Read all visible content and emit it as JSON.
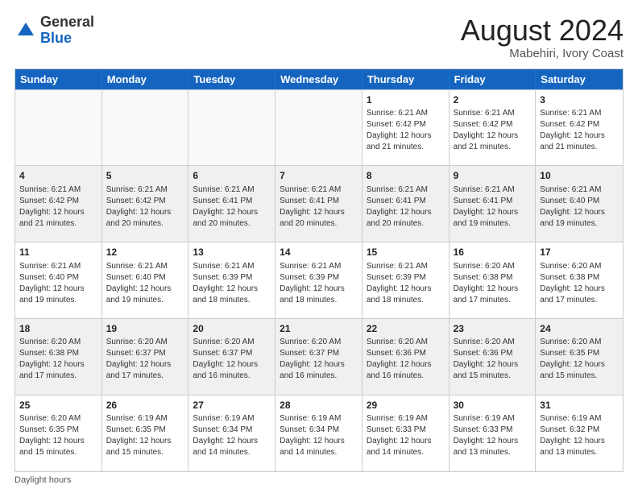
{
  "header": {
    "logo_general": "General",
    "logo_blue": "Blue",
    "title": "August 2024",
    "location": "Mabehiri, Ivory Coast"
  },
  "days_of_week": [
    "Sunday",
    "Monday",
    "Tuesday",
    "Wednesday",
    "Thursday",
    "Friday",
    "Saturday"
  ],
  "weeks": [
    [
      {
        "day": "",
        "info": ""
      },
      {
        "day": "",
        "info": ""
      },
      {
        "day": "",
        "info": ""
      },
      {
        "day": "",
        "info": ""
      },
      {
        "day": "1",
        "info": "Sunrise: 6:21 AM\nSunset: 6:42 PM\nDaylight: 12 hours\nand 21 minutes."
      },
      {
        "day": "2",
        "info": "Sunrise: 6:21 AM\nSunset: 6:42 PM\nDaylight: 12 hours\nand 21 minutes."
      },
      {
        "day": "3",
        "info": "Sunrise: 6:21 AM\nSunset: 6:42 PM\nDaylight: 12 hours\nand 21 minutes."
      }
    ],
    [
      {
        "day": "4",
        "info": "Sunrise: 6:21 AM\nSunset: 6:42 PM\nDaylight: 12 hours\nand 21 minutes."
      },
      {
        "day": "5",
        "info": "Sunrise: 6:21 AM\nSunset: 6:42 PM\nDaylight: 12 hours\nand 20 minutes."
      },
      {
        "day": "6",
        "info": "Sunrise: 6:21 AM\nSunset: 6:41 PM\nDaylight: 12 hours\nand 20 minutes."
      },
      {
        "day": "7",
        "info": "Sunrise: 6:21 AM\nSunset: 6:41 PM\nDaylight: 12 hours\nand 20 minutes."
      },
      {
        "day": "8",
        "info": "Sunrise: 6:21 AM\nSunset: 6:41 PM\nDaylight: 12 hours\nand 20 minutes."
      },
      {
        "day": "9",
        "info": "Sunrise: 6:21 AM\nSunset: 6:41 PM\nDaylight: 12 hours\nand 19 minutes."
      },
      {
        "day": "10",
        "info": "Sunrise: 6:21 AM\nSunset: 6:40 PM\nDaylight: 12 hours\nand 19 minutes."
      }
    ],
    [
      {
        "day": "11",
        "info": "Sunrise: 6:21 AM\nSunset: 6:40 PM\nDaylight: 12 hours\nand 19 minutes."
      },
      {
        "day": "12",
        "info": "Sunrise: 6:21 AM\nSunset: 6:40 PM\nDaylight: 12 hours\nand 19 minutes."
      },
      {
        "day": "13",
        "info": "Sunrise: 6:21 AM\nSunset: 6:39 PM\nDaylight: 12 hours\nand 18 minutes."
      },
      {
        "day": "14",
        "info": "Sunrise: 6:21 AM\nSunset: 6:39 PM\nDaylight: 12 hours\nand 18 minutes."
      },
      {
        "day": "15",
        "info": "Sunrise: 6:21 AM\nSunset: 6:39 PM\nDaylight: 12 hours\nand 18 minutes."
      },
      {
        "day": "16",
        "info": "Sunrise: 6:20 AM\nSunset: 6:38 PM\nDaylight: 12 hours\nand 17 minutes."
      },
      {
        "day": "17",
        "info": "Sunrise: 6:20 AM\nSunset: 6:38 PM\nDaylight: 12 hours\nand 17 minutes."
      }
    ],
    [
      {
        "day": "18",
        "info": "Sunrise: 6:20 AM\nSunset: 6:38 PM\nDaylight: 12 hours\nand 17 minutes."
      },
      {
        "day": "19",
        "info": "Sunrise: 6:20 AM\nSunset: 6:37 PM\nDaylight: 12 hours\nand 17 minutes."
      },
      {
        "day": "20",
        "info": "Sunrise: 6:20 AM\nSunset: 6:37 PM\nDaylight: 12 hours\nand 16 minutes."
      },
      {
        "day": "21",
        "info": "Sunrise: 6:20 AM\nSunset: 6:37 PM\nDaylight: 12 hours\nand 16 minutes."
      },
      {
        "day": "22",
        "info": "Sunrise: 6:20 AM\nSunset: 6:36 PM\nDaylight: 12 hours\nand 16 minutes."
      },
      {
        "day": "23",
        "info": "Sunrise: 6:20 AM\nSunset: 6:36 PM\nDaylight: 12 hours\nand 15 minutes."
      },
      {
        "day": "24",
        "info": "Sunrise: 6:20 AM\nSunset: 6:35 PM\nDaylight: 12 hours\nand 15 minutes."
      }
    ],
    [
      {
        "day": "25",
        "info": "Sunrise: 6:20 AM\nSunset: 6:35 PM\nDaylight: 12 hours\nand 15 minutes."
      },
      {
        "day": "26",
        "info": "Sunrise: 6:19 AM\nSunset: 6:35 PM\nDaylight: 12 hours\nand 15 minutes."
      },
      {
        "day": "27",
        "info": "Sunrise: 6:19 AM\nSunset: 6:34 PM\nDaylight: 12 hours\nand 14 minutes."
      },
      {
        "day": "28",
        "info": "Sunrise: 6:19 AM\nSunset: 6:34 PM\nDaylight: 12 hours\nand 14 minutes."
      },
      {
        "day": "29",
        "info": "Sunrise: 6:19 AM\nSunset: 6:33 PM\nDaylight: 12 hours\nand 14 minutes."
      },
      {
        "day": "30",
        "info": "Sunrise: 6:19 AM\nSunset: 6:33 PM\nDaylight: 12 hours\nand 13 minutes."
      },
      {
        "day": "31",
        "info": "Sunrise: 6:19 AM\nSunset: 6:32 PM\nDaylight: 12 hours\nand 13 minutes."
      }
    ]
  ],
  "footer": {
    "note": "Daylight hours"
  }
}
